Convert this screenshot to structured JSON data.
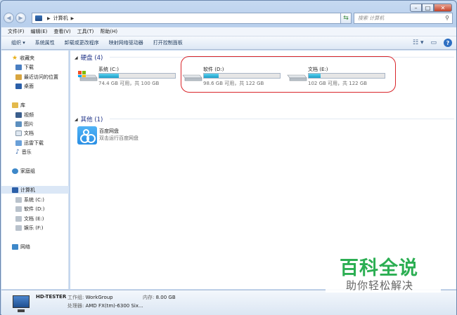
{
  "address": {
    "crumb": "计算机"
  },
  "search": {
    "placeholder": "搜索 计算机"
  },
  "menu": [
    "文件(F)",
    "编辑(E)",
    "查看(V)",
    "工具(T)",
    "帮助(H)"
  ],
  "toolbar": {
    "organize": "组织 ▾",
    "system_properties": "系统属性",
    "uninstall": "卸载或更改程序",
    "map_drive": "映射网络驱动器",
    "control_panel": "打开控制面板"
  },
  "nav": {
    "favorites": "收藏夹",
    "downloads": "下载",
    "recent": "最近访问的位置",
    "desktop": "桌面",
    "libraries": "库",
    "videos": "视频",
    "pictures": "图片",
    "documents": "文档",
    "thunder": "迅雷下载",
    "music": "音乐",
    "homegroup": "家庭组",
    "computer": "计算机",
    "drive_c": "系统 (C:)",
    "drive_d": "软件 (D:)",
    "drive_e": "文档 (E:)",
    "drive_f": "娱乐 (F:)",
    "network": "网络"
  },
  "groups": {
    "hard_disks": "硬盘 (4)",
    "other": "其他 (1)"
  },
  "drives": [
    {
      "name": "系统 (C:)",
      "free_text": "74.4 GB 可用，共 100 GB",
      "used_fraction": 0.256
    },
    {
      "name": "软件 (D:)",
      "free_text": "98.6 GB 可用，共 122 GB",
      "used_fraction": 0.19
    },
    {
      "name": "文档 (E:)",
      "free_text": "102 GB 可用，共 122 GB",
      "used_fraction": 0.16
    }
  ],
  "other_item": {
    "name": "百度网盘",
    "desc": "双击运行百度网盘"
  },
  "details": {
    "hostname": "HD-TESTER",
    "workgroup_label": "工作组:",
    "workgroup": "WorkGroup",
    "memory_label": "内存:",
    "memory": "8.00 GB",
    "cpu_label": "处理器:",
    "cpu": "AMD FX(tm)-6300 Six..."
  },
  "watermark": {
    "line1": "百科全说",
    "line2": "助你轻松解决"
  }
}
